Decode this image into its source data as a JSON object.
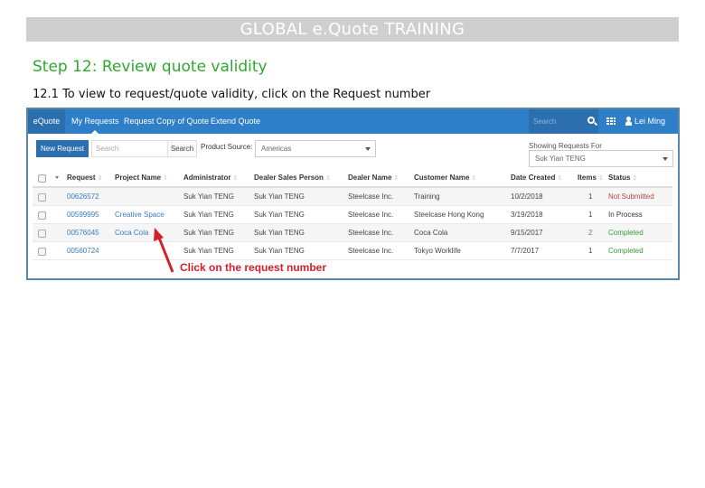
{
  "banner": {
    "title": "GLOBAL e.Quote TRAINING"
  },
  "step": {
    "title": "Step 12: Review quote validity",
    "instruction": "12.1   To view to request/quote validity, click on the Request number"
  },
  "app": {
    "navbar": {
      "brand": "eQuote",
      "items": [
        {
          "label": "My Requests",
          "active": true
        },
        {
          "label": "Request Copy of Quote",
          "active": false
        },
        {
          "label": "Extend Quote",
          "active": false
        }
      ],
      "search_placeholder": "Search",
      "search_icon": "search-icon",
      "apps_icon": "grid-icon",
      "user_icon": "user-icon",
      "user_name": "Lei Ming Yap"
    },
    "toolbar": {
      "new_request_label": "New Request",
      "search_placeholder": "Search",
      "search_button": "Search",
      "product_source_label": "Product Source:",
      "product_source_value": "Americas",
      "showing_label": "Showing Requests For",
      "showing_value": "Suk Yian TENG"
    },
    "table": {
      "headers": [
        "Request",
        "Project Name",
        "Administrator",
        "Dealer Sales Person",
        "Dealer Name",
        "Customer Name",
        "Date Created",
        "Items",
        "Status"
      ],
      "rows": [
        {
          "request": "00626572",
          "project": "",
          "administrator": "Suk Yian TENG",
          "sales_person": "Suk Yian TENG",
          "dealer": "Steelcase Inc.",
          "customer": "Training",
          "date": "10/2/2018",
          "items": "1",
          "status": "Not Submitted"
        },
        {
          "request": "00599995",
          "project": "Creative Space",
          "administrator": "Suk Yian TENG",
          "sales_person": "Suk Yian TENG",
          "dealer": "Steelcase Inc.",
          "customer": "Steelcase Hong Kong",
          "date": "3/19/2018",
          "items": "1",
          "status": "In Process"
        },
        {
          "request": "00576045",
          "project": "Coca Cola",
          "administrator": "Suk Yian TENG",
          "sales_person": "Suk Yian TENG",
          "dealer": "Steelcase Inc.",
          "customer": "Coca Cola",
          "date": "9/15/2017",
          "items": "2",
          "status": "Completed"
        },
        {
          "request": "00560724",
          "project": "",
          "administrator": "Suk Yian TENG",
          "sales_person": "Suk Yian TENG",
          "dealer": "Steelcase Inc.",
          "customer": "Tokyo Worklife",
          "date": "7/7/2017",
          "items": "1",
          "status": "Completed"
        }
      ]
    },
    "annotation": "Click on the request number",
    "colors": {
      "navbar": "#2f7fc8",
      "brand": "#2b6fae",
      "annotation": "#d4202a",
      "step_title": "#2ea82e"
    }
  }
}
